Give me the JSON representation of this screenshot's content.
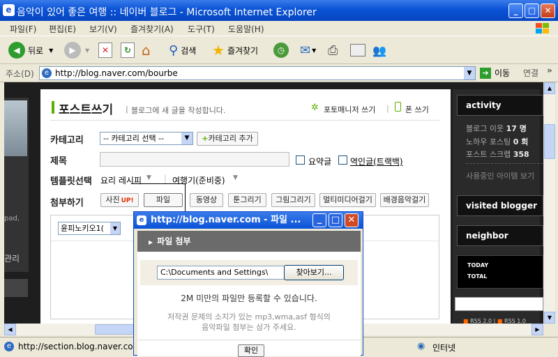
{
  "window": {
    "title": "음악이 있어 좋은 여행 :: 네이버 블로그 - Microsoft Internet Explorer"
  },
  "menu": [
    "파일(F)",
    "편집(E)",
    "보기(V)",
    "즐겨찾기(A)",
    "도구(T)",
    "도움말(H)"
  ],
  "toolbar": {
    "back": "뒤로",
    "search": "검색",
    "favorites": "즐겨찾기"
  },
  "address": {
    "label": "주소(D)",
    "url": "http://blog.naver.com/bourbe",
    "go": "이동",
    "links": "연결"
  },
  "post": {
    "title": "포스트쓰기",
    "subtitle": "블로그에 새 글을 작성합니다.",
    "photo_manager": "포토매니저 쓰기",
    "phone": "폰 쓰기",
    "category_label": "카테고리",
    "category_value": "-- 카테고리 선택 --",
    "category_add": "카테고리 추가",
    "title_label": "제목",
    "summary": "요약글",
    "trackback": "역인글(트랙백)",
    "template_label": "템플릿선택",
    "template1": "요리 레시피",
    "template2": "여행기(준비중)",
    "attach_label": "첨부하기",
    "attach_buttons": [
      "사진",
      "파일",
      "동영상",
      "툰그리기",
      "그림그리기",
      "멀티미디어걸기",
      "배경음악걸기"
    ],
    "photo_up": "UP!",
    "font_value": "윤피노키오1("
  },
  "sidebar": {
    "activity": "activity",
    "stats": [
      {
        "label": "블로그 이웃",
        "value": "17 명"
      },
      {
        "label": "노하우 포스팅",
        "value": "0 회"
      },
      {
        "label": "포스트 스크랩",
        "value": "358"
      }
    ],
    "item_label": "사용중인 아이템 보기",
    "visited": "visited blogger",
    "neighbor": "neighbor",
    "today": "TODAY",
    "total": "TOTAL",
    "rss1": "RSS 2.0",
    "rss2": "RSS 1.0"
  },
  "left_fragments": {
    "a": "pad,",
    "b": "관리"
  },
  "popup": {
    "title": "http://blog.naver.com - 파일 ...",
    "section": "파일 첨부",
    "path": "C:\\Documents and Settings\\",
    "browse": "찾아보기...",
    "limit": "2M 미만의 파일만 등록할 수 있습니다.",
    "warn1": "저작권 문제의 소지가 있는 mp3,wma,asf 형식의",
    "warn2": "음악파일 첨부는 삼가 주세요.",
    "ok": "확인"
  },
  "status": {
    "url": "http://section.blog.naver.com",
    "zone": "인터넷"
  }
}
